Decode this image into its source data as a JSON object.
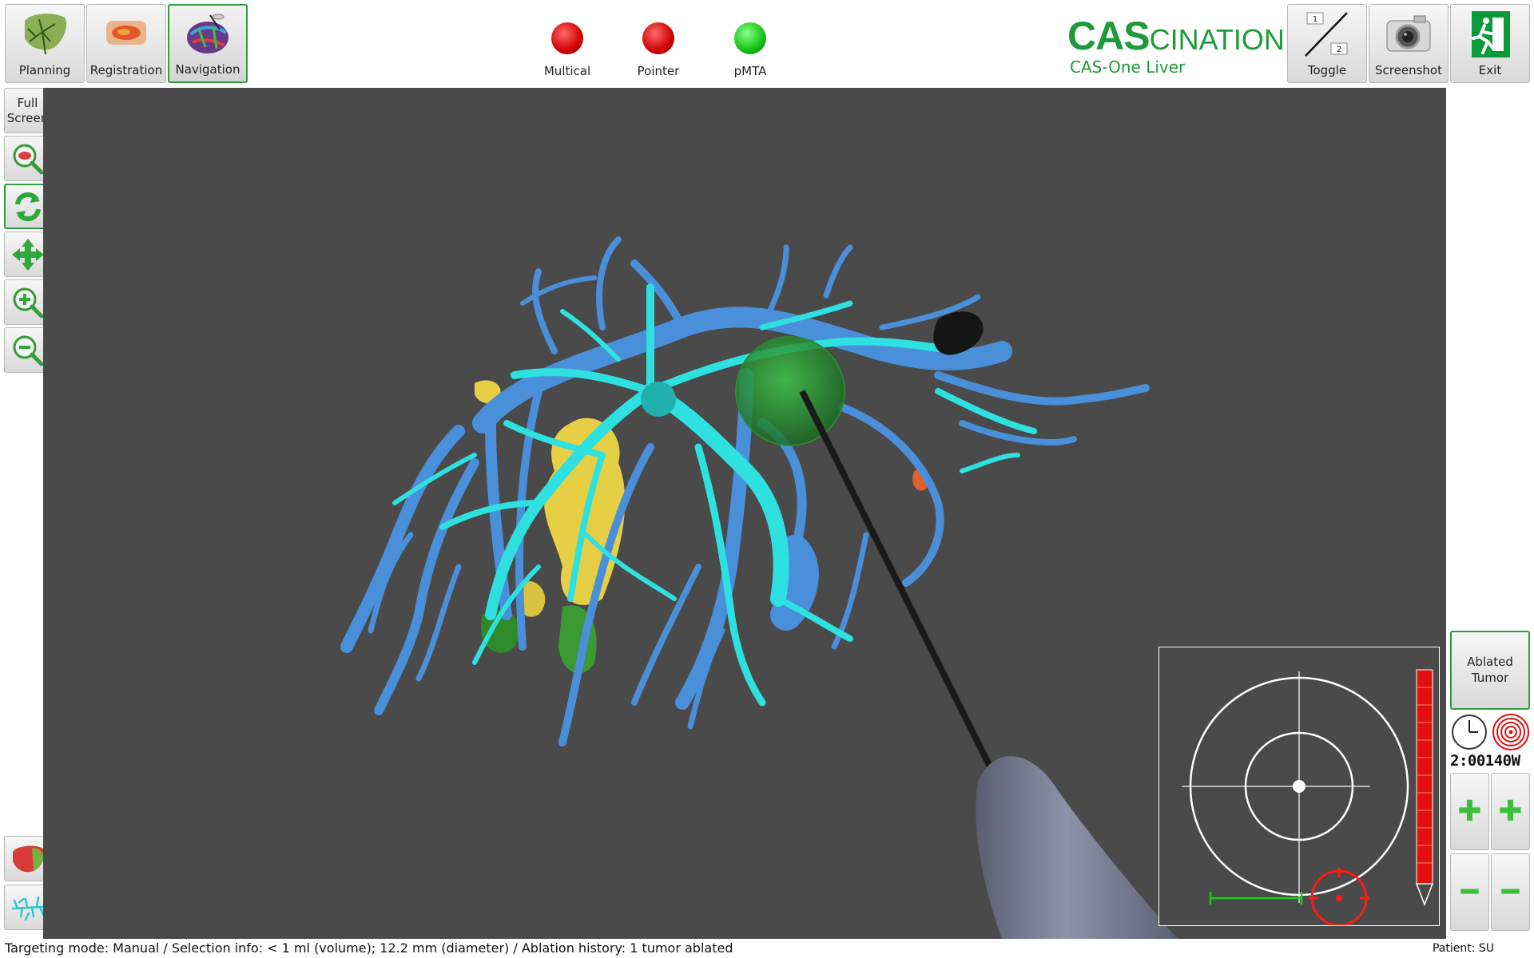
{
  "modes": [
    {
      "label": "Planning",
      "icon": "liver-vessels-icon",
      "active": false
    },
    {
      "label": "Registration",
      "icon": "registration-icon",
      "active": false
    },
    {
      "label": "Navigation",
      "icon": "navigation-icon",
      "active": true
    }
  ],
  "status_indicators": [
    {
      "label": "Multical",
      "color": "#e01010"
    },
    {
      "label": "Pointer",
      "color": "#e01010"
    },
    {
      "label": "pMTA",
      "color": "#22cc22"
    }
  ],
  "brand": {
    "title_bold": "CAS",
    "title_rest": "CINATION",
    "subtitle": "CAS-One Liver",
    "color": "#1e9a3a"
  },
  "toolbar_right": {
    "toggle": {
      "label": "Toggle",
      "icon": "toggle-icon",
      "num1": "1",
      "num2": "2"
    },
    "screenshot": {
      "label": "Screenshot",
      "icon": "camera-icon"
    },
    "exit": {
      "label": "Exit",
      "icon": "exit-icon"
    }
  },
  "left_toolbar": {
    "fullscreen_label": "Full Screen",
    "buttons": [
      "zoom-fit-icon",
      "rotate-icon",
      "pan-icon",
      "zoom-in-icon",
      "zoom-out-icon"
    ],
    "bottom": [
      "liver-surface-icon",
      "vessels-icon"
    ]
  },
  "right_panel": {
    "ablated_label": "Ablated Tumor",
    "time": "2:00",
    "power": "140W"
  },
  "statusbar": {
    "info": "Targeting mode: Manual / Selection info:  < 1 ml (volume); 12.2 mm (diameter) / Ablation history: 1 tumor ablated",
    "patient": "Patient: SU"
  },
  "colors": {
    "portal_vein": "#4a8fd9",
    "hepatic_vein": "#2ee0e0",
    "tumor_yellow": "#e8d24a",
    "tumor_green": "#3fa83a",
    "ablation_zone": "#2fa03a",
    "viewport_bg": "#4a4a4a"
  }
}
